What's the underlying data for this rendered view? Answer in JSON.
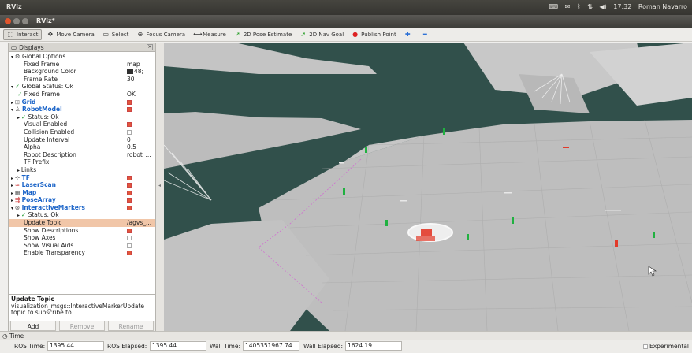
{
  "system_bar": {
    "app_name": "RViz",
    "tray_icons": [
      "keyboard-icon",
      "mail-icon",
      "bluetooth-icon",
      "network-icon",
      "volume-icon"
    ],
    "clock": "17:32",
    "user": "Roman Navarro"
  },
  "window": {
    "title": "RViz*"
  },
  "toolbar": [
    {
      "label": "Interact",
      "icon": "interact-icon",
      "active": true
    },
    {
      "label": "Move Camera",
      "icon": "move-camera-icon"
    },
    {
      "label": "Select",
      "icon": "select-icon"
    },
    {
      "label": "Focus Camera",
      "icon": "focus-camera-icon"
    },
    {
      "label": "Measure",
      "icon": "measure-icon"
    },
    {
      "label": "2D Pose Estimate",
      "icon": "pose-estimate-icon"
    },
    {
      "label": "2D Nav Goal",
      "icon": "nav-goal-icon"
    },
    {
      "label": "Publish Point",
      "icon": "publish-point-icon"
    },
    {
      "label": "",
      "icon": "plus-icon"
    },
    {
      "label": "",
      "icon": "minus-icon"
    }
  ],
  "displays": {
    "title": "Displays",
    "rows": [
      {
        "indent": 0,
        "label": "Global Options",
        "value": "",
        "icon": "gear-icon",
        "expand": "open"
      },
      {
        "indent": 2,
        "label": "Fixed Frame",
        "value": "map"
      },
      {
        "indent": 2,
        "label": "Background Color",
        "value": "48;",
        "swatch": true
      },
      {
        "indent": 2,
        "label": "Frame Rate",
        "value": "30"
      },
      {
        "indent": 0,
        "label": "Global Status: Ok",
        "value": "",
        "icon": "check-icon",
        "expand": "open"
      },
      {
        "indent": 1,
        "label": "Fixed Frame",
        "value": "OK",
        "icon": "check-icon"
      },
      {
        "indent": 0,
        "label": "Grid",
        "value": "",
        "icon": "grid-icon",
        "expand": "closed",
        "blue": true,
        "checked": true
      },
      {
        "indent": 0,
        "label": "RobotModel",
        "value": "",
        "icon": "robot-icon",
        "expand": "open",
        "blue": true,
        "checked": true
      },
      {
        "indent": 1,
        "label": "Status: Ok",
        "value": "",
        "icon": "check-icon",
        "expand": "closed"
      },
      {
        "indent": 2,
        "label": "Visual Enabled",
        "value": "",
        "checked": true
      },
      {
        "indent": 2,
        "label": "Collision Enabled",
        "value": "",
        "checked": false
      },
      {
        "indent": 2,
        "label": "Update Interval",
        "value": "0"
      },
      {
        "indent": 2,
        "label": "Alpha",
        "value": "0.5"
      },
      {
        "indent": 2,
        "label": "Robot Description",
        "value": "robot_..."
      },
      {
        "indent": 2,
        "label": "TF Prefix",
        "value": ""
      },
      {
        "indent": 1,
        "label": "Links",
        "value": "",
        "expand": "closed"
      },
      {
        "indent": 0,
        "label": "TF",
        "value": "",
        "icon": "tf-icon",
        "expand": "closed",
        "blue": true,
        "checked": true
      },
      {
        "indent": 0,
        "label": "LaserScan",
        "value": "",
        "icon": "laser-icon",
        "expand": "closed",
        "blue": true,
        "checked": true
      },
      {
        "indent": 0,
        "label": "Map",
        "value": "",
        "icon": "map-icon",
        "expand": "closed",
        "blue": true,
        "checked": true
      },
      {
        "indent": 0,
        "label": "PoseArray",
        "value": "",
        "icon": "pose-array-icon",
        "expand": "closed",
        "blue": true,
        "checked": true
      },
      {
        "indent": 0,
        "label": "InteractiveMarkers",
        "value": "",
        "icon": "markers-icon",
        "expand": "open",
        "blue": true,
        "checked": true
      },
      {
        "indent": 1,
        "label": "Status: Ok",
        "value": "",
        "icon": "check-icon",
        "expand": "closed"
      },
      {
        "indent": 2,
        "label": "Update Topic",
        "value": "/agvs_...",
        "selected": true
      },
      {
        "indent": 2,
        "label": "Show Descriptions",
        "value": "",
        "checked": true
      },
      {
        "indent": 2,
        "label": "Show Axes",
        "value": "",
        "checked": false
      },
      {
        "indent": 2,
        "label": "Show Visual Aids",
        "value": "",
        "checked": false
      },
      {
        "indent": 2,
        "label": "Enable Transparency",
        "value": "",
        "checked": true
      }
    ],
    "help_title": "Update Topic",
    "help_text": "visualization_msgs::InteractiveMarkerUpdate topic to subscribe to.",
    "buttons": {
      "add": "Add",
      "remove": "Remove",
      "rename": "Rename"
    }
  },
  "time": {
    "header": "Time",
    "ros_time_label": "ROS Time:",
    "ros_time": "1395.44",
    "ros_elapsed_label": "ROS Elapsed:",
    "ros_elapsed": "1395.44",
    "wall_time_label": "Wall Time:",
    "wall_time": "1405351967.74",
    "wall_elapsed_label": "Wall Elapsed:",
    "wall_elapsed": "1624.19",
    "experimental_label": "Experimental"
  },
  "colors": {
    "background_teal": "#31504b",
    "floor_gray": "#bfbfbf",
    "pose_green": "#20b140",
    "pose_red": "#e23a2a"
  }
}
